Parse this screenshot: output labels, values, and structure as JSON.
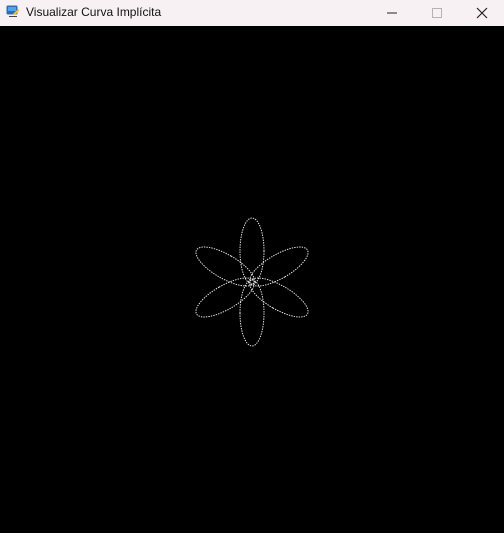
{
  "window": {
    "title": "Visualizar Curva Implícita",
    "icon": "python-app-icon",
    "controls": {
      "minimize": "minimize-icon",
      "maximize": "maximize-icon",
      "close": "close-icon"
    }
  },
  "canvas": {
    "background": "#000000",
    "curve_color": "#ffffff",
    "curve_type": "six-petal implicit flower"
  },
  "colors": {
    "titlebar_background": "#f7f1f4",
    "text": "#111111"
  }
}
